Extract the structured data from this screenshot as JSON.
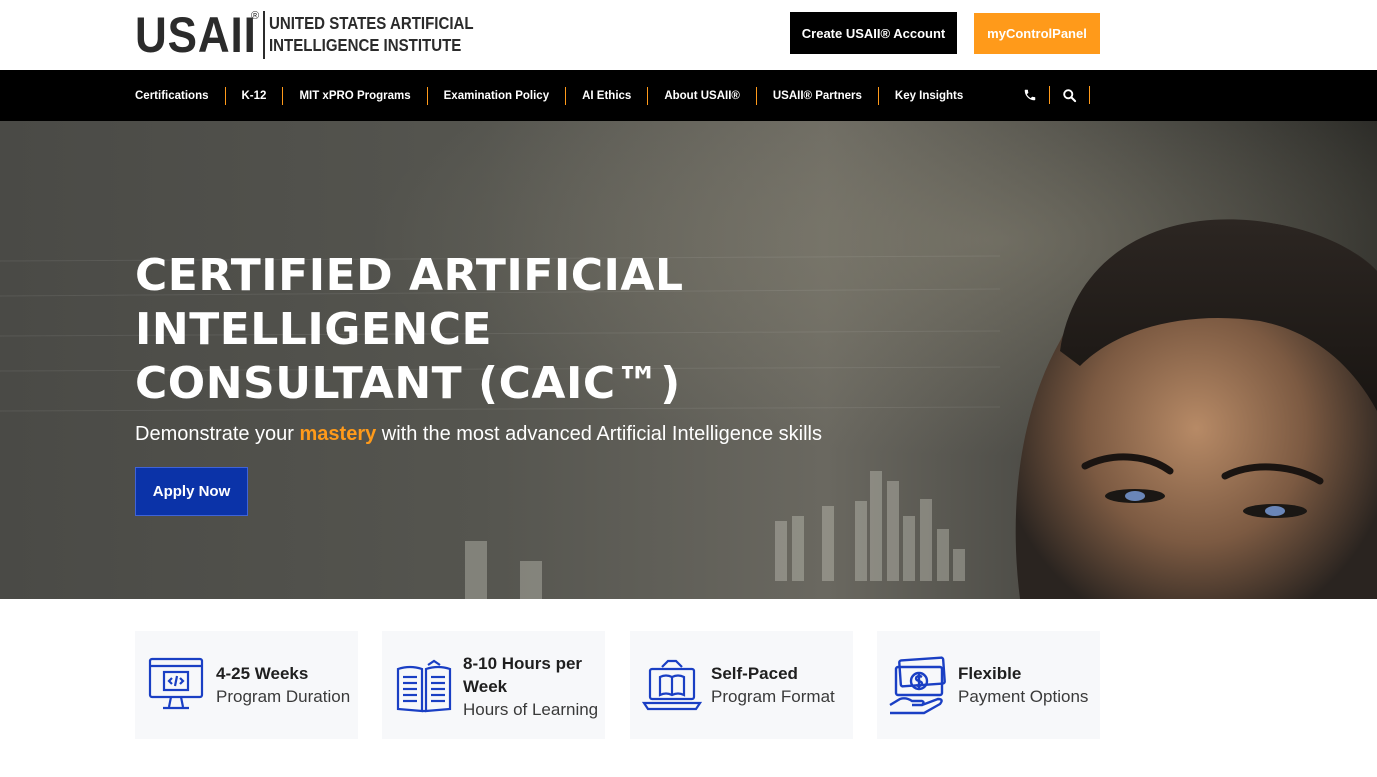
{
  "header": {
    "logo_mark": "USAII",
    "logo_reg": "®",
    "logo_line1": "UNITED STATES ARTIFICIAL",
    "logo_line2": "INTELLIGENCE INSTITUTE",
    "create_account_label": "Create USAII® Account",
    "control_panel_label": "myControlPanel"
  },
  "nav": {
    "items": [
      {
        "label": "Certifications"
      },
      {
        "label": "K-12"
      },
      {
        "label": "MIT xPRO Programs"
      },
      {
        "label": "Examination Policy"
      },
      {
        "label": "AI Ethics"
      },
      {
        "label": "About USAII®"
      },
      {
        "label": "USAII® Partners"
      },
      {
        "label": "Key Insights"
      }
    ],
    "icons": [
      "phone-icon",
      "search-icon"
    ]
  },
  "hero": {
    "title_line1": "CERTIFIED ARTIFICIAL",
    "title_line2": "INTELLIGENCE",
    "title_line3": "CONSULTANT (CAIC™)",
    "subtitle_before": "Demonstrate your ",
    "subtitle_accent": "mastery",
    "subtitle_after": " with the most advanced Artificial Intelligence skills",
    "apply_label": "Apply Now"
  },
  "features": [
    {
      "title": "4-25 Weeks",
      "subtitle": "Program Duration",
      "icon": "code-monitor-icon"
    },
    {
      "title": "8-10 Hours per Week",
      "subtitle": "Hours of Learning",
      "icon": "open-book-icon"
    },
    {
      "title": "Self-Paced",
      "subtitle": "Program Format",
      "icon": "laptop-book-icon"
    },
    {
      "title": "Flexible",
      "subtitle": "Payment Options",
      "icon": "money-hand-icon"
    }
  ],
  "colors": {
    "accent_orange": "#ff9a1a",
    "apply_blue": "#0b33a8",
    "icon_blue": "#1a3fc4",
    "nav_black": "#000000"
  }
}
